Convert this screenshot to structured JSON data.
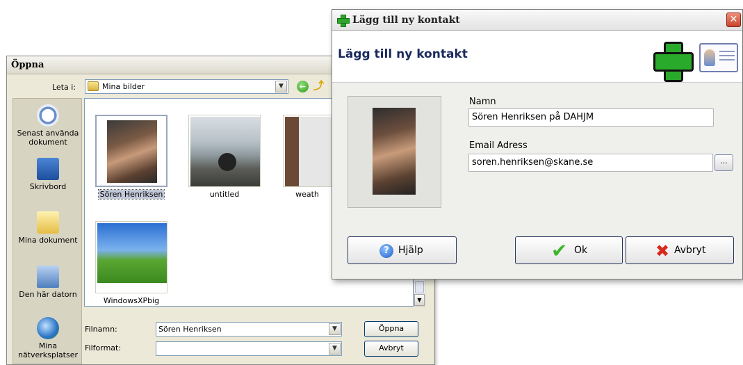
{
  "open_dialog": {
    "title": "Öppna",
    "lookin_label": "Leta i:",
    "lookin_value": "Mina bilder",
    "places": [
      {
        "label": "Senast använda dokument",
        "icon": "recent-documents-icon"
      },
      {
        "label": "Skrivbord",
        "icon": "desktop-icon"
      },
      {
        "label": "Mina dokument",
        "icon": "my-documents-icon"
      },
      {
        "label": "Den här datorn",
        "icon": "my-computer-icon"
      },
      {
        "label": "Mina nätverksplatser",
        "icon": "network-places-icon"
      }
    ],
    "files": [
      {
        "name": "Sören Henriksen",
        "selected": true
      },
      {
        "name": "untitled"
      },
      {
        "name": "weath"
      },
      {
        "name": "WindowsXPbig"
      }
    ],
    "filename_label": "Filnamn:",
    "filename_value": "Sören Henriksen",
    "filetype_label": "Filformat:",
    "filetype_value": "",
    "open_button": "Öppna",
    "cancel_button": "Avbryt"
  },
  "add_contact": {
    "window_title": "Lägg till ny kontakt",
    "header_title": "Lägg till ny kontakt",
    "name_label": "Namn",
    "name_value": "Sören Henriksen på DAHJM",
    "email_label": "Email Adress",
    "email_value": "soren.henriksen@skane.se",
    "browse_button": "...",
    "help_button": "Hjälp",
    "ok_button": "Ok",
    "cancel_button": "Avbryt",
    "close_glyph": "✕"
  }
}
